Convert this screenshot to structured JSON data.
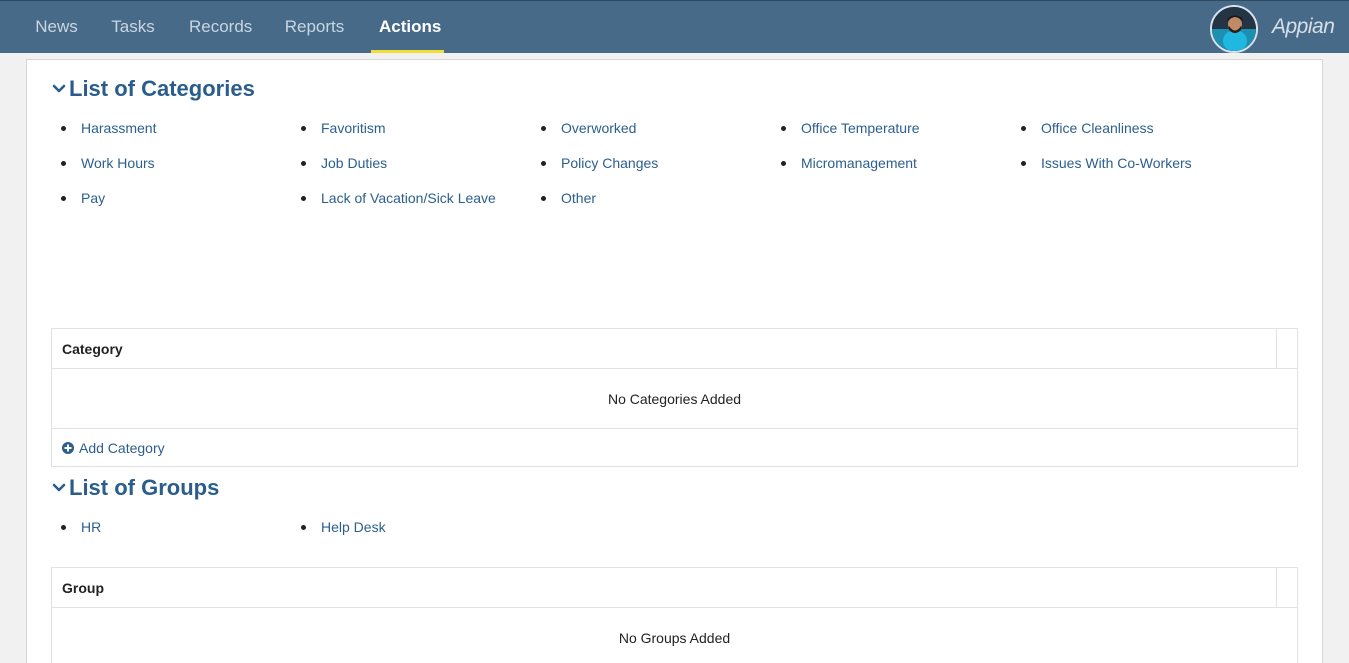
{
  "nav": {
    "tabs": [
      {
        "label": "News"
      },
      {
        "label": "Tasks"
      },
      {
        "label": "Records"
      },
      {
        "label": "Reports"
      },
      {
        "label": "Actions",
        "active": true
      }
    ],
    "brand": "Appian",
    "active_underline_color": "#f1dd38",
    "bar_color": "#476a89"
  },
  "categories_section": {
    "title": "List of Categories",
    "items": [
      "Harassment",
      "Work Hours",
      "Pay",
      "Favoritism",
      "Job Duties",
      "Lack of Vacation/Sick Leave",
      "Overworked",
      "Policy Changes",
      "Other",
      "Office Temperature",
      "Micromanagement",
      "Office Cleanliness",
      "Issues With Co-Workers"
    ],
    "grid": {
      "header": "Category",
      "empty_text": "No Categories Added",
      "add_label": "Add Category"
    }
  },
  "groups_section": {
    "title": "List of Groups",
    "items": [
      "HR",
      "Help Desk"
    ],
    "grid": {
      "header": "Group",
      "empty_text": "No Groups Added"
    }
  },
  "colors": {
    "link": "#2c5f8e",
    "heading": "#2a5d8c"
  }
}
